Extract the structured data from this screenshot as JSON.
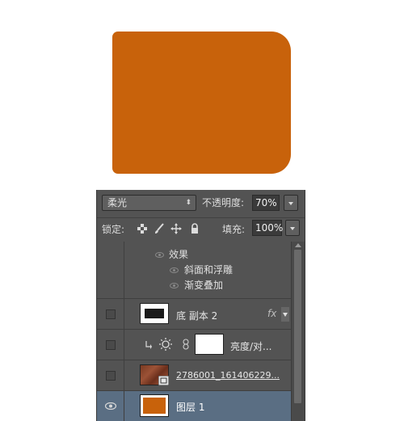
{
  "blend_mode": {
    "selected": "柔光",
    "options": [
      "柔光"
    ]
  },
  "opacity": {
    "label": "不透明度:",
    "value": "70%"
  },
  "lock": {
    "label": "锁定:"
  },
  "fill": {
    "label": "填充:",
    "value": "100%"
  },
  "colors": {
    "shape": "#c8620b",
    "panel": "#535353",
    "selected_row": "#5a6e83"
  },
  "icons": {
    "lock_transparent": "checkerboard-icon",
    "lock_image": "brush-icon",
    "lock_position": "move-arrows-icon",
    "lock_all": "padlock-icon",
    "visibility": "eye-icon",
    "fx": "fx-icon",
    "adjustment": "sun-icon",
    "link": "chain-link-icon",
    "clip": "clipping-arrow-icon",
    "smart_object": "smart-object-badge-icon"
  },
  "effects": {
    "header": "效果",
    "items": [
      "斜面和浮雕",
      "渐变叠加"
    ]
  },
  "layers": [
    {
      "name": "底 副本 2",
      "fx": "fx",
      "visible": false,
      "selected": false
    },
    {
      "name": "亮度/对...",
      "visible": false,
      "selected": false
    },
    {
      "name": "2786001_161406229...",
      "visible": false,
      "selected": false
    },
    {
      "name": "图层 1",
      "visible": true,
      "selected": true
    }
  ]
}
